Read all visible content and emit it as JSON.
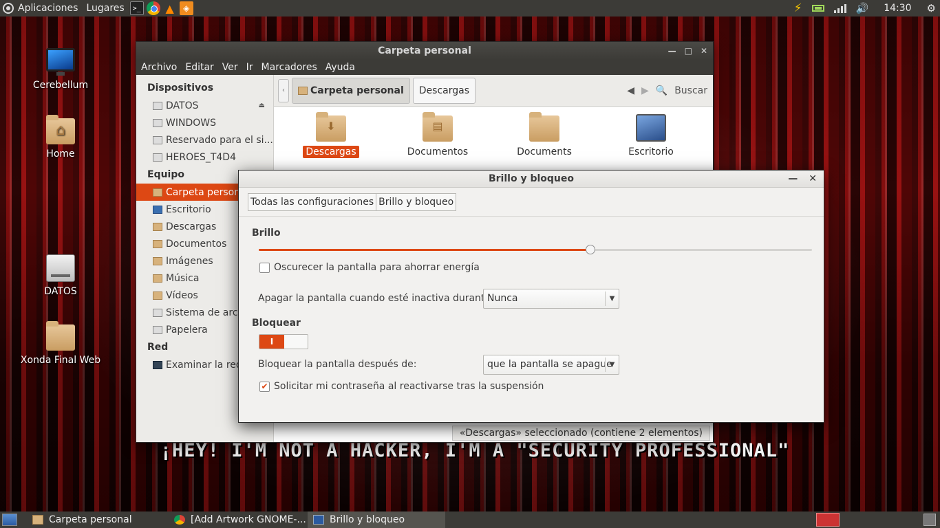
{
  "top_panel": {
    "apps_menu": "Aplicaciones",
    "places_menu": "Lugares",
    "launchers": [
      "terminal-icon",
      "chrome-icon",
      "vlc-icon",
      "image-viewer-icon"
    ],
    "tray_icons": [
      "power-icon",
      "battery-icon",
      "network-signal-icon",
      "volume-icon"
    ],
    "clock": "14:30",
    "gear_icon": "gear-icon"
  },
  "desktop": {
    "icons": [
      {
        "label": "Cerebellum",
        "icon": "monitor-icon"
      },
      {
        "label": "Home",
        "icon": "home-folder-icon"
      },
      {
        "label": "DATOS",
        "icon": "drive-icon"
      },
      {
        "label": "Xonda Final Web",
        "icon": "folder-icon"
      }
    ],
    "slogan": "¡HEY! I'M NOT A HACKER, I'M A \"SECURITY PROFESSIONAL\""
  },
  "file_manager": {
    "title": "Carpeta personal",
    "menu": [
      "Archivo",
      "Editar",
      "Ver",
      "Ir",
      "Marcadores",
      "Ayuda"
    ],
    "sidebar": {
      "devices_header": "Dispositivos",
      "devices": [
        "DATOS",
        "WINDOWS",
        "Reservado para el si...",
        "HEROES_T4D4"
      ],
      "equipment_header": "Equipo",
      "equipment": [
        "Carpeta personal",
        "Escritorio",
        "Descargas",
        "Documentos",
        "Imágenes",
        "Música",
        "Vídeos",
        "Sistema de archivos",
        "Papelera"
      ],
      "network_header": "Red",
      "network": [
        "Examinar la red"
      ]
    },
    "breadcrumbs": [
      "Carpeta personal",
      "Descargas"
    ],
    "search_label": "Buscar",
    "files": [
      {
        "label": "Descargas",
        "selected": true
      },
      {
        "label": "Documentos",
        "selected": false
      },
      {
        "label": "Documents",
        "selected": false
      },
      {
        "label": "Escritorio",
        "selected": false
      }
    ],
    "status": "«Descargas» seleccionado (contiene 2 elementos)"
  },
  "settings_dialog": {
    "title": "Brillo y bloqueo",
    "nav_all": "Todas las configuraciones",
    "nav_current": "Brillo y bloqueo",
    "brightness_header": "Brillo",
    "brightness_level": 0.6,
    "dim_screen_label": "Oscurecer la pantalla para ahorrar energía",
    "dim_screen_checked": false,
    "screen_off_label": "Apagar la pantalla cuando esté inactiva durante:",
    "screen_off_value": "Nunca",
    "lock_header": "Bloquear",
    "lock_toggle_on": true,
    "lock_toggle_on_text": "I",
    "lock_after_label": "Bloquear la pantalla después de:",
    "lock_after_value": "que la pantalla se apague",
    "require_password_label": "Solicitar mi contraseña al reactivarse tras la suspensión",
    "require_password_checked": true
  },
  "taskbar": {
    "tasks": [
      {
        "label": "Carpeta personal",
        "icon": "folder-icon",
        "active": false
      },
      {
        "label": "[Add  Artwork GNOME-...",
        "icon": "chrome-icon",
        "active": false
      },
      {
        "label": "Brillo y bloqueo",
        "icon": "settings-icon",
        "active": true
      }
    ]
  },
  "colors": {
    "accent": "#dd4814",
    "panel": "#3c3b37",
    "dialog_bg": "#f2f1ef"
  }
}
